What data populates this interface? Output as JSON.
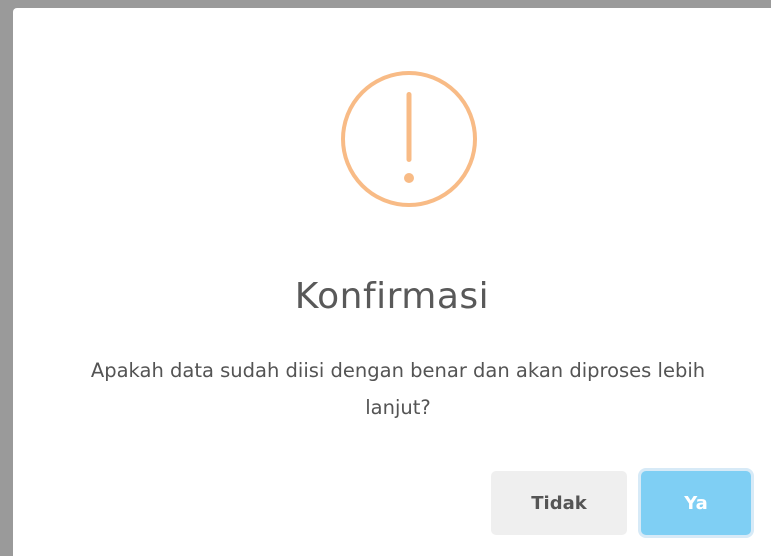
{
  "dialog": {
    "icon": "warning-exclamation-icon",
    "icon_color": "#f8bb86",
    "title": "Konfirmasi",
    "message": "Apakah data sudah diisi dengan benar dan akan diproses lebih lanjut?",
    "cancel_label": "Tidak",
    "confirm_label": "Ya",
    "confirm_color": "#7fcff4",
    "cancel_color": "#efefef"
  }
}
